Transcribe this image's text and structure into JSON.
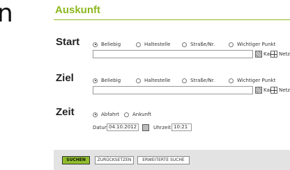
{
  "edge_text": "n",
  "title": "Auskunft",
  "options": {
    "beliebig": "Beliebig",
    "haltestelle": "Haltestelle",
    "strasse": "Straße/Nr.",
    "wichtiger_punkt": "Wichtiger Punkt"
  },
  "links": {
    "karte": "Karte",
    "netzplan": "Netzplan"
  },
  "start": {
    "label": "Start",
    "selected": "Beliebig",
    "value": ""
  },
  "ziel": {
    "label": "Ziel",
    "selected": "Beliebig",
    "value": ""
  },
  "zeit": {
    "label": "Zeit",
    "abfahrt": "Abfahrt",
    "ankunft": "Ankunft",
    "selected": "Abfahrt",
    "datum_label": "Datum",
    "datum_value": "04.10.2012",
    "uhrzeit_label": "Uhrzeit",
    "uhrzeit_value": "10:21"
  },
  "buttons": {
    "suchen": "SUCHEN",
    "zuruecksetzen": "ZURÜCKSETZEN",
    "erweiterte_suche": "ERWEITERTE SUCHE"
  },
  "colors": {
    "accent": "#8db820",
    "button_primary": "#8fbd2a",
    "footer_bar": "#e3e3e3"
  }
}
